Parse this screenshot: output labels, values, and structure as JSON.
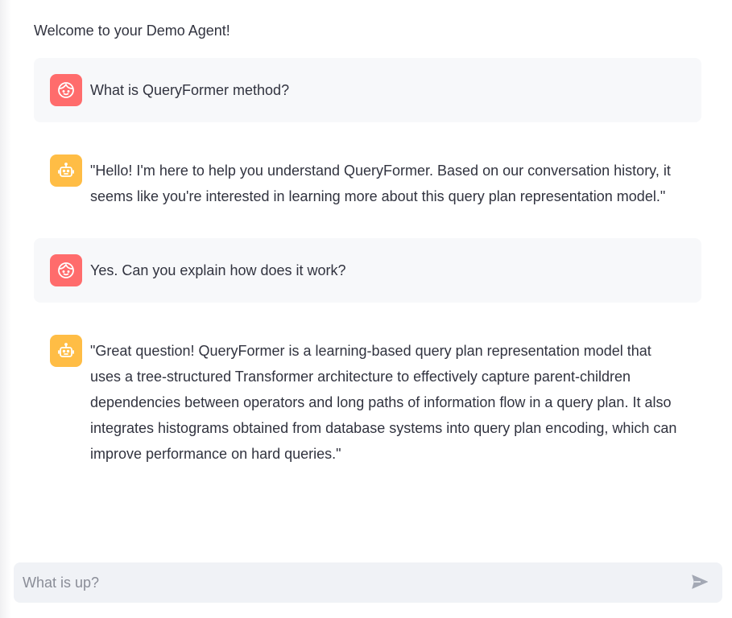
{
  "welcome": "Welcome to your Demo Agent!",
  "messages": [
    {
      "role": "user",
      "avatar_icon": "user-face-icon",
      "text": "What is QueryFormer method?"
    },
    {
      "role": "assistant",
      "avatar_icon": "robot-icon",
      "text": "\"Hello! I'm here to help you understand QueryFormer. Based on our conversation history, it seems like you're interested in learning more about this query plan representation model.\""
    },
    {
      "role": "user",
      "avatar_icon": "user-face-icon",
      "text": "Yes. Can you explain how does it work?"
    },
    {
      "role": "assistant",
      "avatar_icon": "robot-icon",
      "text": "\"Great question! QueryFormer is a learning-based query plan representation model that uses a tree-structured Transformer architecture to effectively capture parent-children dependencies between operators and long paths of information flow in a query plan. It also integrates histograms obtained from database systems into query plan encoding, which can improve performance on hard queries.\""
    }
  ],
  "chat_input": {
    "placeholder": "What is up?",
    "value": "",
    "send_icon": "send-icon"
  },
  "colors": {
    "user_avatar": "#ff6c6c",
    "assistant_avatar": "#ffbd45",
    "user_bubble": "#f7f8fa",
    "input_bg": "#f0f2f6"
  }
}
